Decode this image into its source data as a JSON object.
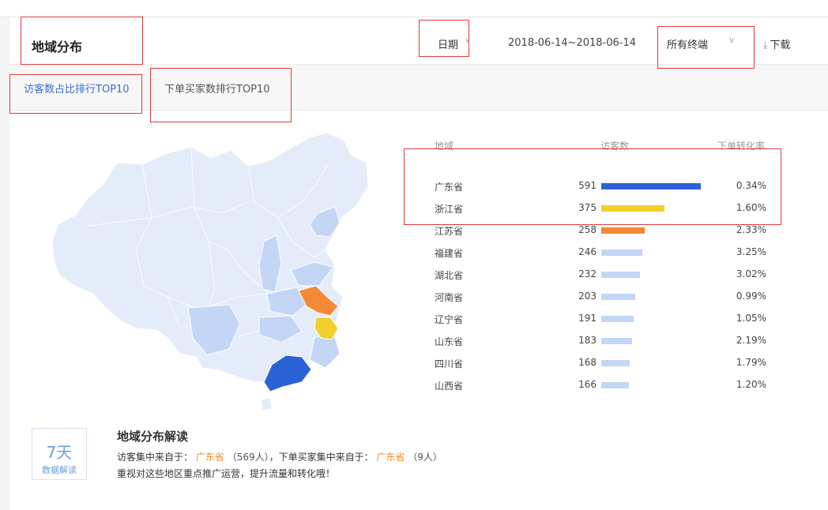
{
  "header": {
    "title": "地域分布",
    "date_label": "日期",
    "date_range": "2018-06-14~2018-06-14",
    "terminal": "所有终端",
    "download": "下载"
  },
  "tabs": [
    {
      "label": "访客数占比排行TOP10",
      "active": true
    },
    {
      "label": "下单买家数排行TOP10",
      "active": false
    }
  ],
  "table": {
    "headers": {
      "region": "地域",
      "visitors": "访客数",
      "conversion": "下单转化率"
    },
    "rows": [
      {
        "province": "广东省",
        "visitors": 591,
        "rate": "0.34%",
        "color": "#2a62d6"
      },
      {
        "province": "浙江省",
        "visitors": 375,
        "rate": "1.60%",
        "color": "#f0d02a"
      },
      {
        "province": "江苏省",
        "visitors": 258,
        "rate": "2.33%",
        "color": "#f48a35"
      },
      {
        "province": "福建省",
        "visitors": 246,
        "rate": "3.25%",
        "color": "#c4d6f5"
      },
      {
        "province": "湖北省",
        "visitors": 232,
        "rate": "3.02%",
        "color": "#c4d6f5"
      },
      {
        "province": "河南省",
        "visitors": 203,
        "rate": "0.99%",
        "color": "#c4d6f5"
      },
      {
        "province": "辽宁省",
        "visitors": 191,
        "rate": "1.05%",
        "color": "#c4d6f5"
      },
      {
        "province": "山东省",
        "visitors": 183,
        "rate": "2.19%",
        "color": "#c4d6f5"
      },
      {
        "province": "四川省",
        "visitors": 168,
        "rate": "1.79%",
        "color": "#c4d6f5"
      },
      {
        "province": "山西省",
        "visitors": 166,
        "rate": "1.20%",
        "color": "#c4d6f5"
      }
    ]
  },
  "interpretation": {
    "badge_number": "7天",
    "badge_sub": "数据解读",
    "title": "地域分布解读",
    "visitors_prefix": "访客集中来自于：",
    "visitors_province": "广东省",
    "visitors_count": "（569人）",
    "buyers_prefix": "，下单买家集中来自于：",
    "buyers_province": "广东省",
    "buyers_count": "（9人）",
    "advice": "重视对这些地区重点推广运营，提升流量和转化哦！"
  },
  "colors": {
    "accent": "#3b6fd1",
    "top1": "#2a62d6",
    "top2": "#f0d02a",
    "top3": "#f48a35",
    "other": "#c4d6f5",
    "map_base": "#e4ecf9",
    "highlight_box": "#e23a3a"
  }
}
